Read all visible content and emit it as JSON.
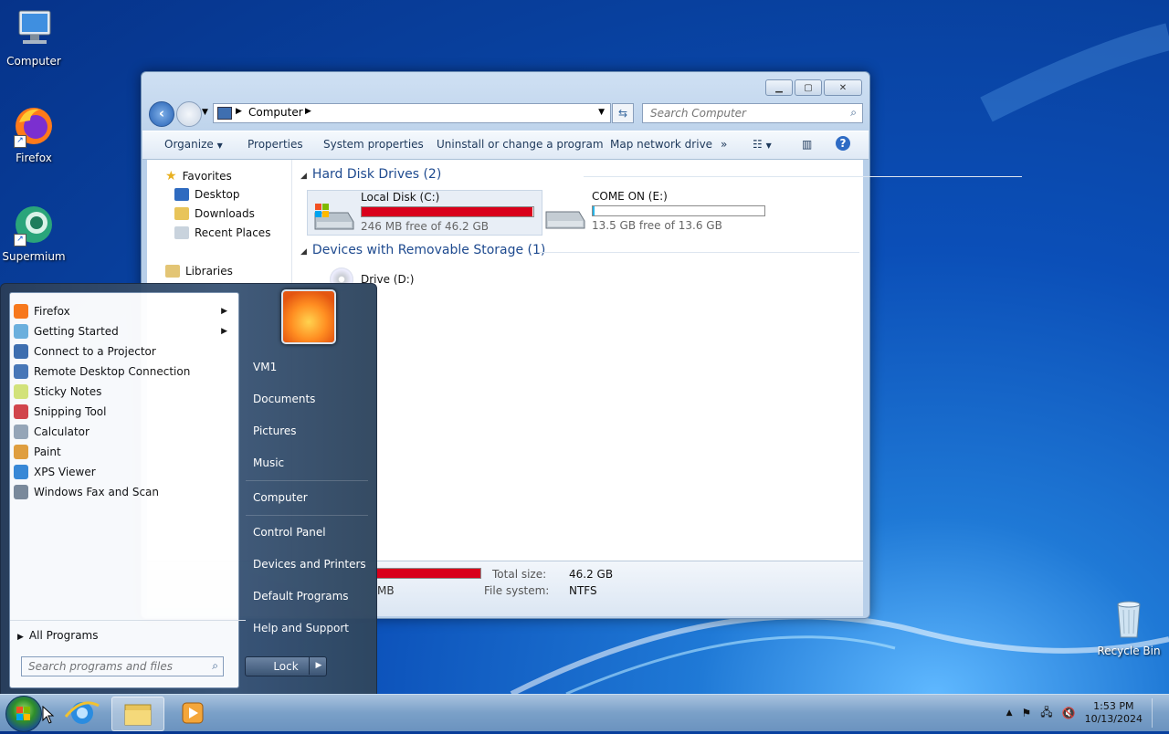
{
  "desktop": {
    "icons": [
      {
        "label": "Computer"
      },
      {
        "label": "Firefox"
      },
      {
        "label": "Supermium"
      },
      {
        "label": "Recycle Bin"
      }
    ]
  },
  "explorer": {
    "address": "Computer",
    "search_placeholder": "Search Computer",
    "toolbar": [
      "Organize",
      "Properties",
      "System properties",
      "Uninstall or change a program",
      "Map network drive",
      "»"
    ],
    "nav": {
      "favorites": "Favorites",
      "items": [
        "Desktop",
        "Downloads",
        "Recent Places"
      ],
      "libraries": "Libraries"
    },
    "sections": {
      "hdd": "Hard Disk Drives (2)",
      "removable": "Devices with Removable Storage (1)"
    },
    "drives": [
      {
        "name": "Local Disk (C:)",
        "free": "246 MB free of 46.2 GB",
        "used_fraction": 0.995,
        "color": "#d9001b"
      },
      {
        "name": "COME ON (E:)",
        "free": "13.5 GB free of 13.6 GB",
        "used_fraction": 0.01,
        "color": "#27b5e8"
      }
    ],
    "dvd": "Drive (D:)",
    "details": {
      "free_partial": "MB",
      "total_label": "Total size:",
      "total_value": "46.2 GB",
      "fs_label": "File system:",
      "fs_value": "NTFS"
    }
  },
  "start_menu": {
    "programs": [
      {
        "label": "Firefox",
        "submenu": true
      },
      {
        "label": "Getting Started",
        "submenu": true
      },
      {
        "label": "Connect to a Projector"
      },
      {
        "label": "Remote Desktop Connection"
      },
      {
        "label": "Sticky Notes"
      },
      {
        "label": "Snipping Tool"
      },
      {
        "label": "Calculator"
      },
      {
        "label": "Paint"
      },
      {
        "label": "XPS Viewer"
      },
      {
        "label": "Windows Fax and Scan"
      }
    ],
    "all_programs": "All Programs",
    "search_placeholder": "Search programs and files",
    "right_links": [
      "VM1",
      "Documents",
      "Pictures",
      "Music",
      "Computer",
      "Control Panel",
      "Devices and Printers",
      "Default Programs",
      "Help and Support"
    ],
    "lock_label": "Lock"
  },
  "taskbar": {
    "time": "1:53 PM",
    "date": "10/13/2024"
  }
}
